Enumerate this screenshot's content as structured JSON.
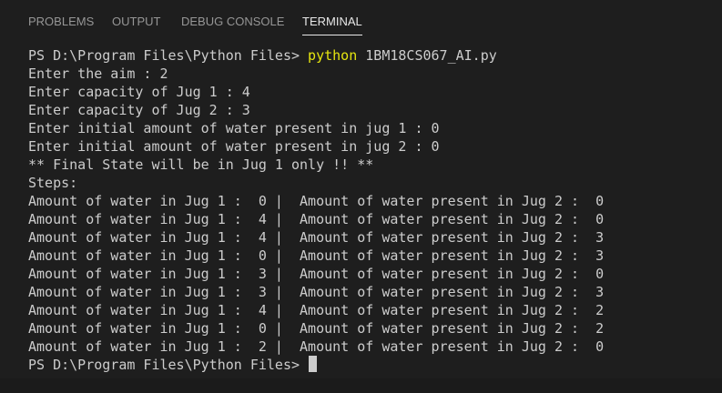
{
  "tabs": [
    {
      "label": "PROBLEMS",
      "active": false
    },
    {
      "label": "OUTPUT",
      "active": false
    },
    {
      "label": "DEBUG CONSOLE",
      "active": false
    },
    {
      "label": "TERMINAL",
      "active": true
    }
  ],
  "terminal": {
    "prompt_text": "PS D:\\Program Files\\Python Files> ",
    "command": "python",
    "command_args": " 1BM18CS067_AI.py",
    "output_lines": [
      "Enter the aim : 2",
      "Enter capacity of Jug 1 : 4",
      "Enter capacity of Jug 2 : 3",
      "Enter initial amount of water present in jug 1 : 0",
      "Enter initial amount of water present in jug 2 : 0",
      "** Final State will be in Jug 1 only !! **",
      "Steps:",
      "Amount of water in Jug 1 :  0 |  Amount of water present in Jug 2 :  0",
      "Amount of water in Jug 1 :  4 |  Amount of water present in Jug 2 :  0",
      "Amount of water in Jug 1 :  4 |  Amount of water present in Jug 2 :  3",
      "Amount of water in Jug 1 :  0 |  Amount of water present in Jug 2 :  3",
      "Amount of water in Jug 1 :  3 |  Amount of water present in Jug 2 :  0",
      "Amount of water in Jug 1 :  3 |  Amount of water present in Jug 2 :  3",
      "Amount of water in Jug 1 :  4 |  Amount of water present in Jug 2 :  2",
      "Amount of water in Jug 1 :  0 |  Amount of water present in Jug 2 :  2",
      "Amount of water in Jug 1 :  2 |  Amount of water present in Jug 2 :  0"
    ],
    "final_prompt": "PS D:\\Program Files\\Python Files>"
  },
  "colors": {
    "background": "#1e1e1e",
    "text": "#cccccc",
    "command": "#e5e510",
    "tab_inactive": "#969696",
    "tab_active": "#e7e7e7"
  }
}
